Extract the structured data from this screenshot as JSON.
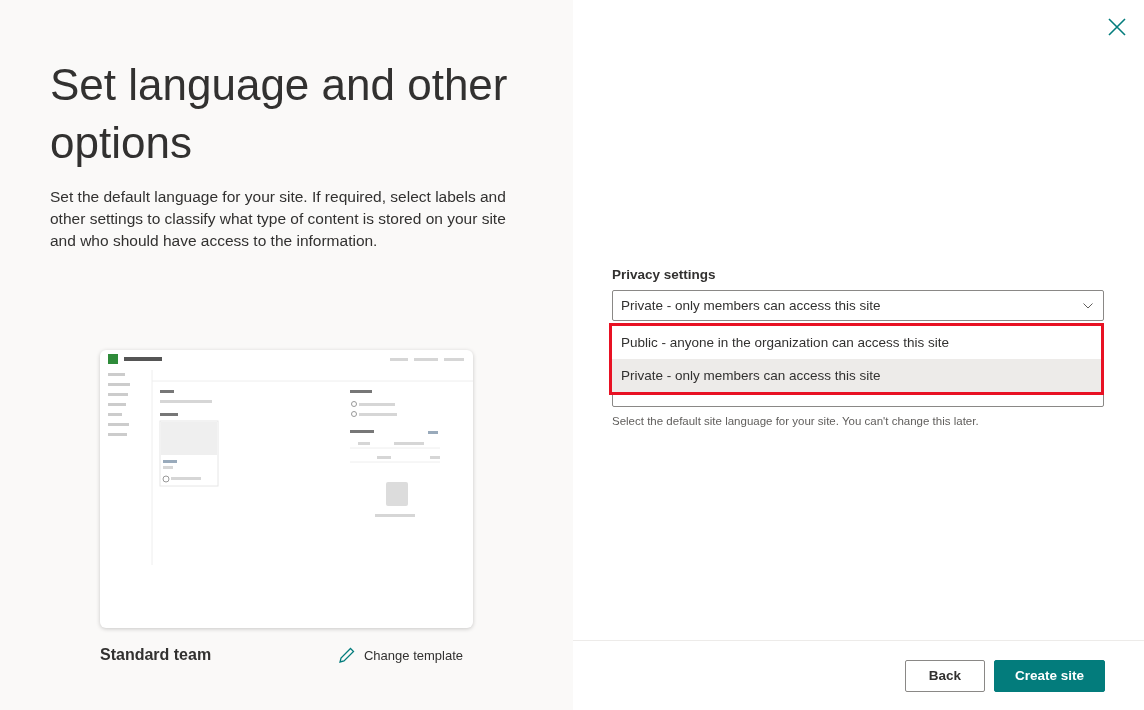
{
  "left": {
    "title": "Set language and other options",
    "description": "Set the default language for your site. If required, select labels and other settings to classify what type of content is stored on your site and who should have access to the information.",
    "template_name": "Standard team",
    "change_template": "Change template"
  },
  "privacy": {
    "label": "Privacy settings",
    "value": "Private - only members can access this site",
    "expanded": true,
    "options": [
      {
        "label": "Public - anyone in the organization can access this site",
        "selected": false
      },
      {
        "label": "Private - only members can access this site",
        "selected": true
      }
    ]
  },
  "language": {
    "help": "Select the default site language for your site. You can't change this later."
  },
  "buttons": [
    {
      "label": "Back",
      "kind": "secondary"
    },
    {
      "label": "Create site",
      "kind": "primary"
    }
  ]
}
